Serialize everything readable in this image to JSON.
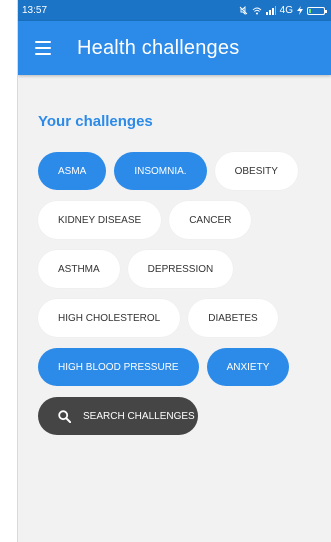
{
  "status_bar": {
    "time": "13:57",
    "network": "4G",
    "icons": [
      "mute-icon",
      "wifi-icon",
      "signal-icon",
      "charging-icon",
      "battery-icon"
    ]
  },
  "app_bar": {
    "title": "Health challenges",
    "menu_icon": "hamburger-menu-icon"
  },
  "section": {
    "title": "Your challenges"
  },
  "chips": [
    {
      "label": "ASMA",
      "selected": true
    },
    {
      "label": "INSOMNIA.",
      "selected": true
    },
    {
      "label": "OBESITY",
      "selected": false
    },
    {
      "label": "KIDNEY DISEASE",
      "selected": false
    },
    {
      "label": "CANCER",
      "selected": false
    },
    {
      "label": "ASTHMA",
      "selected": false
    },
    {
      "label": "DEPRESSION",
      "selected": false
    },
    {
      "label": "HIGH CHOLESTEROL",
      "selected": false
    },
    {
      "label": "DIABETES",
      "selected": false
    },
    {
      "label": "HIGH BLOOD PRESSURE",
      "selected": true
    },
    {
      "label": "ANXIETY",
      "selected": true
    }
  ],
  "search_button": {
    "label": "SEARCH CHALLENGES",
    "icon": "search-icon"
  },
  "colors": {
    "primary": "#2c8ae8",
    "status_bar": "#1c74c6",
    "background": "#f2f2f2",
    "chip_unselected": "#ffffff",
    "search_button": "#454545"
  }
}
